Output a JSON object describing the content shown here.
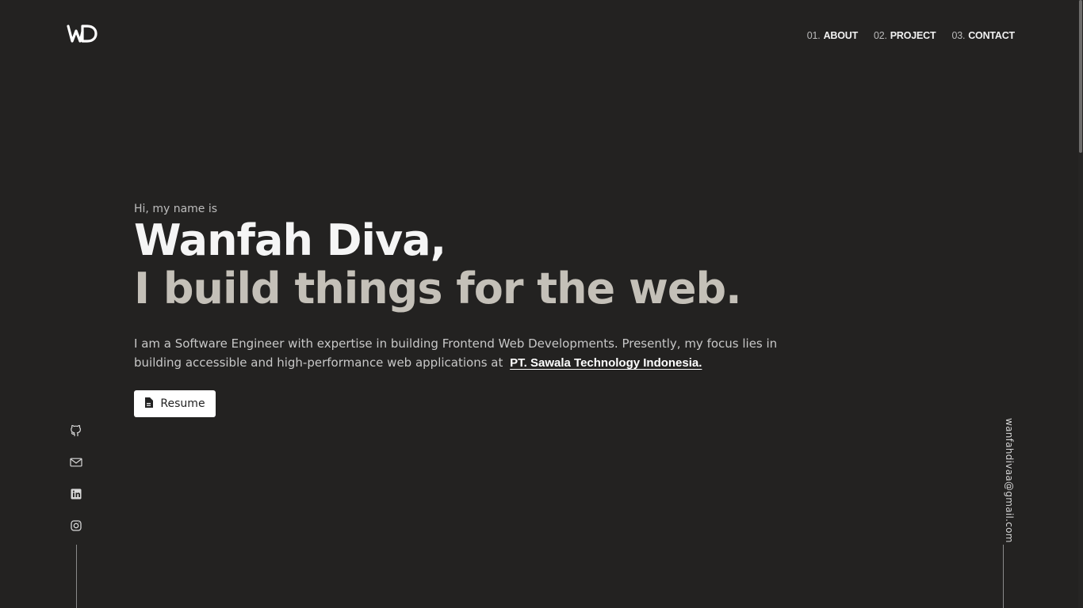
{
  "logo": {
    "alt": "WD",
    "icon": "wd-logo-icon"
  },
  "nav": [
    {
      "num": "01.",
      "label": "ABOUT"
    },
    {
      "num": "02.",
      "label": "PROJECT"
    },
    {
      "num": "03.",
      "label": "CONTACT"
    }
  ],
  "hero": {
    "greeting": "Hi, my name is",
    "name": "Wanfah Diva,",
    "tagline": "I build things for the web.",
    "description": "I am a Software Engineer with expertise in building Frontend Web Developments. Presently, my focus lies in building accessible and high-performance web applications at ",
    "company": "PT. Sawala Technology Indonesia."
  },
  "resume_button": {
    "label": "Resume",
    "icon": "document-icon"
  },
  "socials": [
    {
      "name": "github",
      "icon": "github-icon"
    },
    {
      "name": "email",
      "icon": "mail-icon"
    },
    {
      "name": "linkedin",
      "icon": "linkedin-icon"
    },
    {
      "name": "instagram",
      "icon": "instagram-icon"
    }
  ],
  "email": "wanfahdivaa@gmail.com",
  "colors": {
    "background": "#232221",
    "text": "#f5f5f5",
    "muted": "#c4c0b8"
  }
}
